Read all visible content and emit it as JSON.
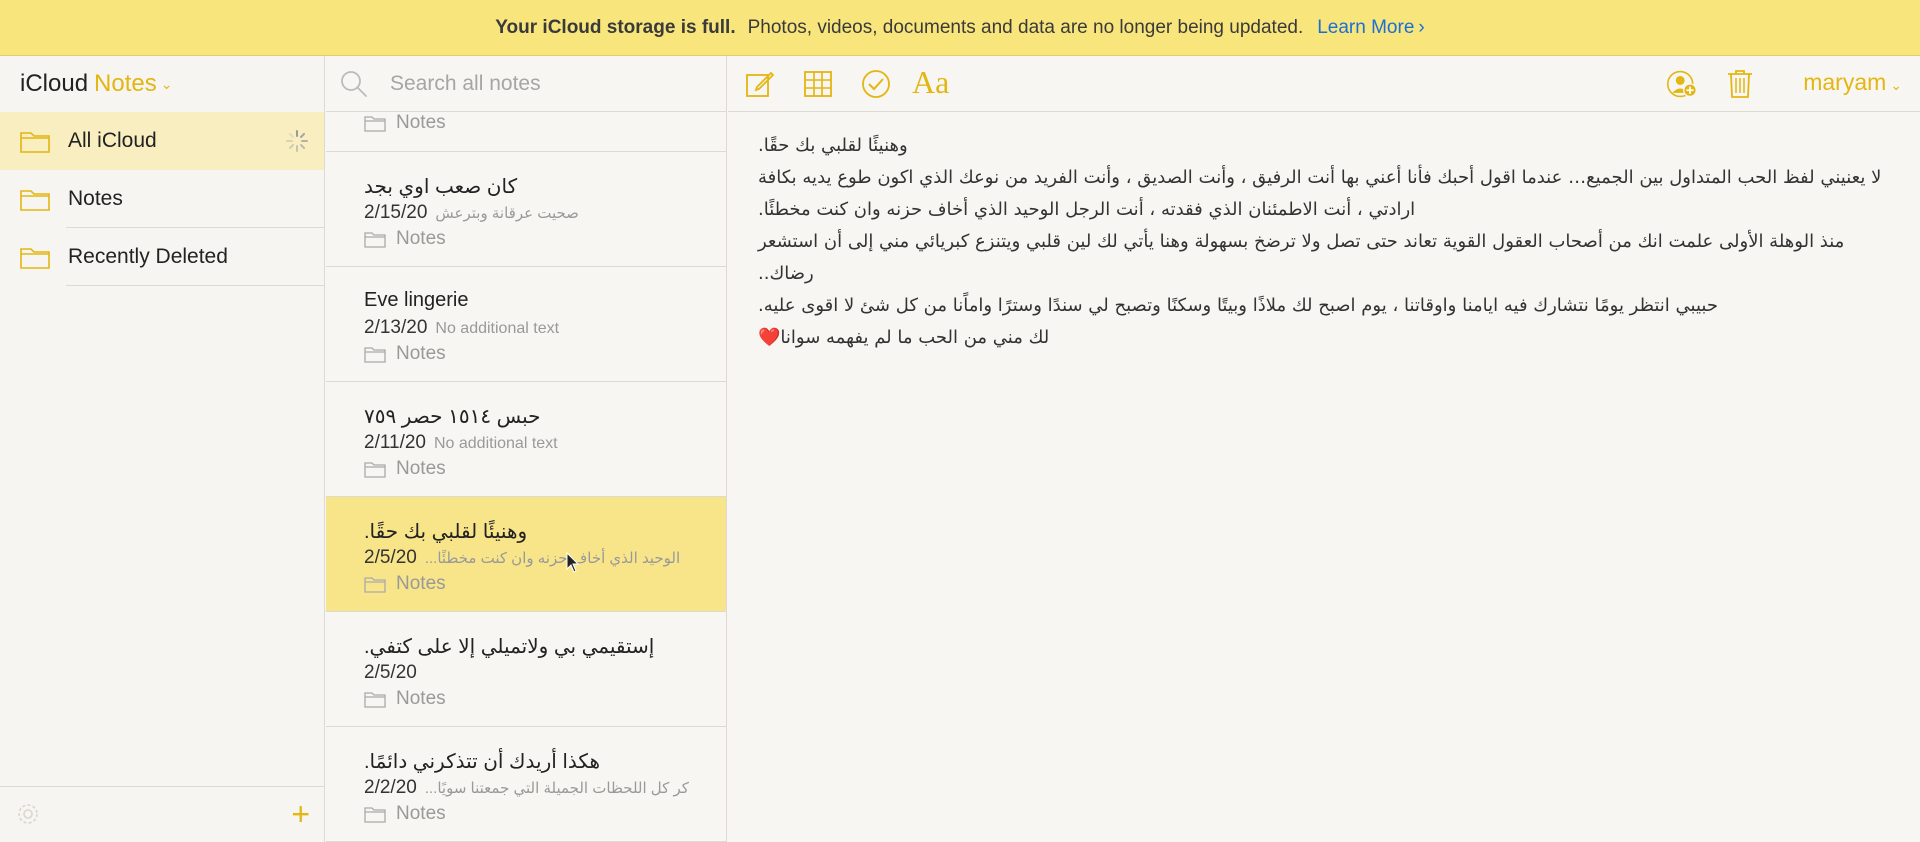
{
  "banner": {
    "strong": "Your iCloud storage is full.",
    "text": "Photos, videos, documents and data are no longer being updated.",
    "link": "Learn More",
    "link_chevron": "›"
  },
  "sidebar": {
    "brand": "iCloud",
    "app": "Notes",
    "folders": [
      {
        "label": "All iCloud",
        "selected": true
      },
      {
        "label": "Notes",
        "selected": false
      },
      {
        "label": "Recently Deleted",
        "selected": false
      }
    ]
  },
  "search": {
    "placeholder": "Search all notes"
  },
  "notes_list": [
    {
      "folder": "Notes"
    },
    {
      "title": "كان صعب اوي بجد",
      "date": "2/15/20",
      "preview": "صحيت عرقانة وبترعش",
      "folder": "Notes"
    },
    {
      "title": "Eve lingerie",
      "date": "2/13/20",
      "preview": "No additional text",
      "folder": "Notes"
    },
    {
      "title": "حبس ١٥١٤ حصر ٧٥٩",
      "date": "2/11/20",
      "preview": "No additional text",
      "folder": "Notes"
    },
    {
      "title": "وهنيئًا لقلبي بك حقًا.",
      "date": "2/5/20",
      "preview": "الوحيد الذي أخاف حزنه وان كنت مخطئًا...",
      "folder": "Notes",
      "selected": true
    },
    {
      "title": "إستقيمي بي ولاتميلي إلا على كتفي.",
      "date": "2/5/20",
      "preview": "",
      "folder": "Notes"
    },
    {
      "title": "هكذا أريدك أن تتذكرني دائمًا.",
      "date": "2/2/20",
      "preview": "كر كل اللحظات الجميلة التي جمعتنا سويًا...",
      "folder": "Notes"
    }
  ],
  "toolbar": {
    "format_label": "Aa",
    "user": "maryam",
    "colors": {
      "accent": "#e3b612"
    }
  },
  "editor": {
    "lines": [
      "وهنيئًا لقلبي بك حقًا.",
      "لا يعنيني لفظ الحب المتداول بين الجميع… عندما اقول أحبك فأنا أعني بها أنت الرفيق ، وأنت الصديق ، وأنت الفريد من نوعك الذي اكون طوع يديه بكافة ارادتي ، أنت الاطمئنان الذي فقدته ، أنت الرجل الوحيد الذي أخاف حزنه وان كنت مخطئًا.",
      "منذ الوهلة الأولى علمت انك من أصحاب العقول القوية تعاند حتى تصل ولا ترضخ بسهولة وهنا يأتي لك لين قلبي ويتنزع كبريائي مني إلى أن استشعر رضاك..",
      "حبيبي انتظر يومًا نتشارك فيه ايامنا واوقاتنا ، يوم اصبح لك ملاذًا وبيتًا وسكنًا وتصبح لي سندًا وسترًا واماًنا من كل شئ لا اقوى عليه.",
      "لك مني من الحب ما لم يفهمه سوانا❤️"
    ]
  }
}
